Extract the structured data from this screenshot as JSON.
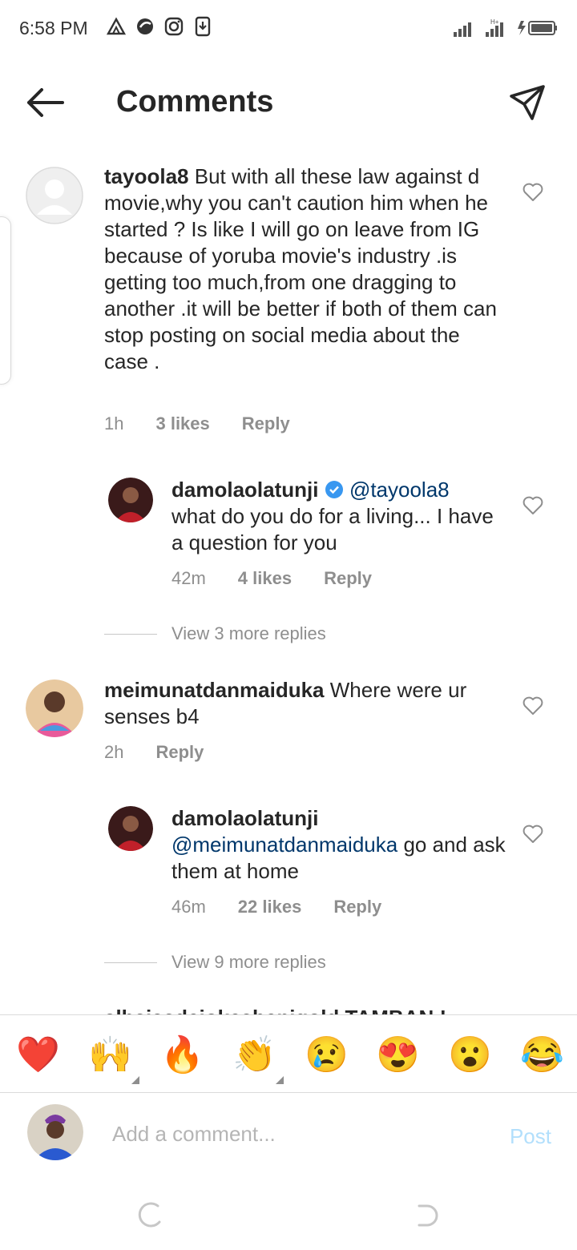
{
  "status_bar": {
    "time": "6:58 PM"
  },
  "header": {
    "title": "Comments",
    "back_icon": "arrow-left-icon",
    "send_icon": "paper-plane-icon"
  },
  "comments": [
    {
      "username": "tayoola8",
      "text": " But with all these law against d  movie,why you can't caution him when he started ? Is like I will go on leave from IG because of yoruba movie's industry .is getting too much,from one dragging to another .it will be better if both of them can stop posting on social media about the case .",
      "time": "1h",
      "likes": "3 likes",
      "reply": "Reply",
      "reply_item": {
        "username": "damolaolatunji",
        "mention": "@tayoola8",
        "text": "what do you do for a living... I have a question for you",
        "time": "42m",
        "likes": "4 likes",
        "reply": "Reply"
      },
      "view_more": "View 3 more replies"
    },
    {
      "username": "meimunatdanmaiduka",
      "text": " Where were ur senses b4",
      "time": "2h",
      "reply": "Reply",
      "reply_item": {
        "username": "damolaolatunji",
        "mention": "@meimunatdanmaiduka",
        "text": " go and ask them at home",
        "time": "46m",
        "likes": "22 likes",
        "reply": "Reply"
      },
      "view_more": "View 9 more replies"
    }
  ],
  "cut_off_comment": "alhajaadejokeabenigold TAMBAN !",
  "emoji_bar": [
    "❤️",
    "🙌",
    "🔥",
    "👏",
    "😢",
    "😍",
    "😮",
    "😂"
  ],
  "input": {
    "placeholder": "Add a comment...",
    "post_label": "Post"
  },
  "colors": {
    "text": "#262626",
    "secondary": "#8e8e8e",
    "mention": "#00376b",
    "verified": "#3897f0",
    "post_disabled": "#b2dffc"
  }
}
